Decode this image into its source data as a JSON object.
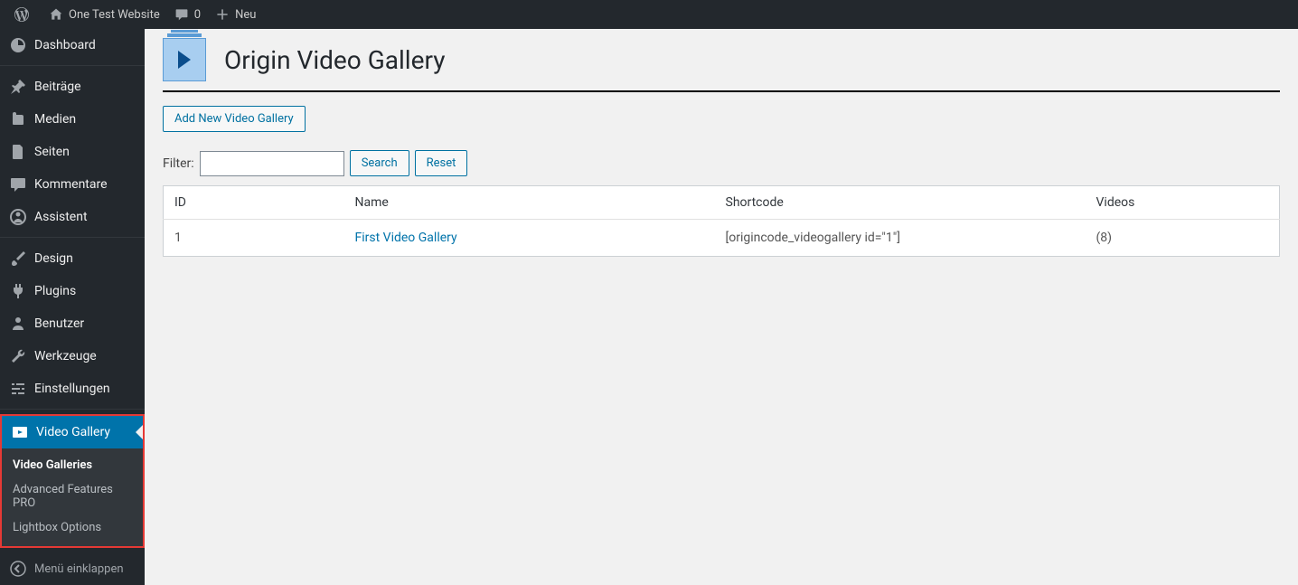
{
  "adminbar": {
    "site_name": "One Test Website",
    "comments_count": "0",
    "new_label": "Neu"
  },
  "sidebar": {
    "items": [
      {
        "label": "Dashboard"
      },
      {
        "label": "Beiträge"
      },
      {
        "label": "Medien"
      },
      {
        "label": "Seiten"
      },
      {
        "label": "Kommentare"
      },
      {
        "label": "Assistent"
      },
      {
        "label": "Design"
      },
      {
        "label": "Plugins"
      },
      {
        "label": "Benutzer"
      },
      {
        "label": "Werkzeuge"
      },
      {
        "label": "Einstellungen"
      },
      {
        "label": "Video Gallery"
      }
    ],
    "submenu": [
      {
        "label": "Video Galleries"
      },
      {
        "label": "Advanced Features PRO"
      },
      {
        "label": "Lightbox Options"
      }
    ],
    "collapse_label": "Menü einklappen"
  },
  "page": {
    "title": "Origin Video Gallery",
    "add_button": "Add New Video Gallery",
    "filter_label": "Filter:",
    "search_label": "Search",
    "reset_label": "Reset",
    "columns": {
      "id": "ID",
      "name": "Name",
      "shortcode": "Shortcode",
      "videos": "Videos"
    },
    "rows": [
      {
        "id": "1",
        "name": "First Video Gallery",
        "shortcode": "[origincode_videogallery id=\"1\"]",
        "videos": "(8)"
      }
    ]
  }
}
